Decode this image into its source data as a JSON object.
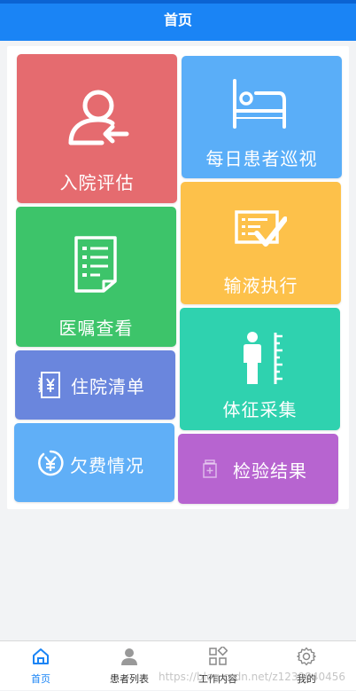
{
  "header": {
    "title": "首页"
  },
  "tiles": {
    "admission": {
      "label": "入院评估",
      "color": "#e56b6f"
    },
    "rounds": {
      "label": "每日患者巡视",
      "color": "#5aaef8"
    },
    "orders": {
      "label": "医嘱查看",
      "color": "#3dc46a"
    },
    "infusion": {
      "label": "输液执行",
      "color": "#fdc14a"
    },
    "bill": {
      "label": "住院清单",
      "color": "#6a86dd"
    },
    "vitals": {
      "label": "体征采集",
      "color": "#2fd2af"
    },
    "arrears": {
      "label": "欠费情况",
      "color": "#60aff7"
    },
    "lab": {
      "label": "检验结果",
      "color": "#b764d0"
    }
  },
  "tabbar": {
    "tabs": [
      {
        "label": "首页",
        "icon": "home-icon",
        "active": true
      },
      {
        "label": "患者列表",
        "icon": "person-icon",
        "active": false
      },
      {
        "label": "工作内容",
        "icon": "grid-icon",
        "active": false
      },
      {
        "label": "我的",
        "icon": "gear-icon",
        "active": false
      }
    ],
    "active_color": "#1a84f5"
  },
  "watermark": "https://blog.csdn.net/z1239840456"
}
